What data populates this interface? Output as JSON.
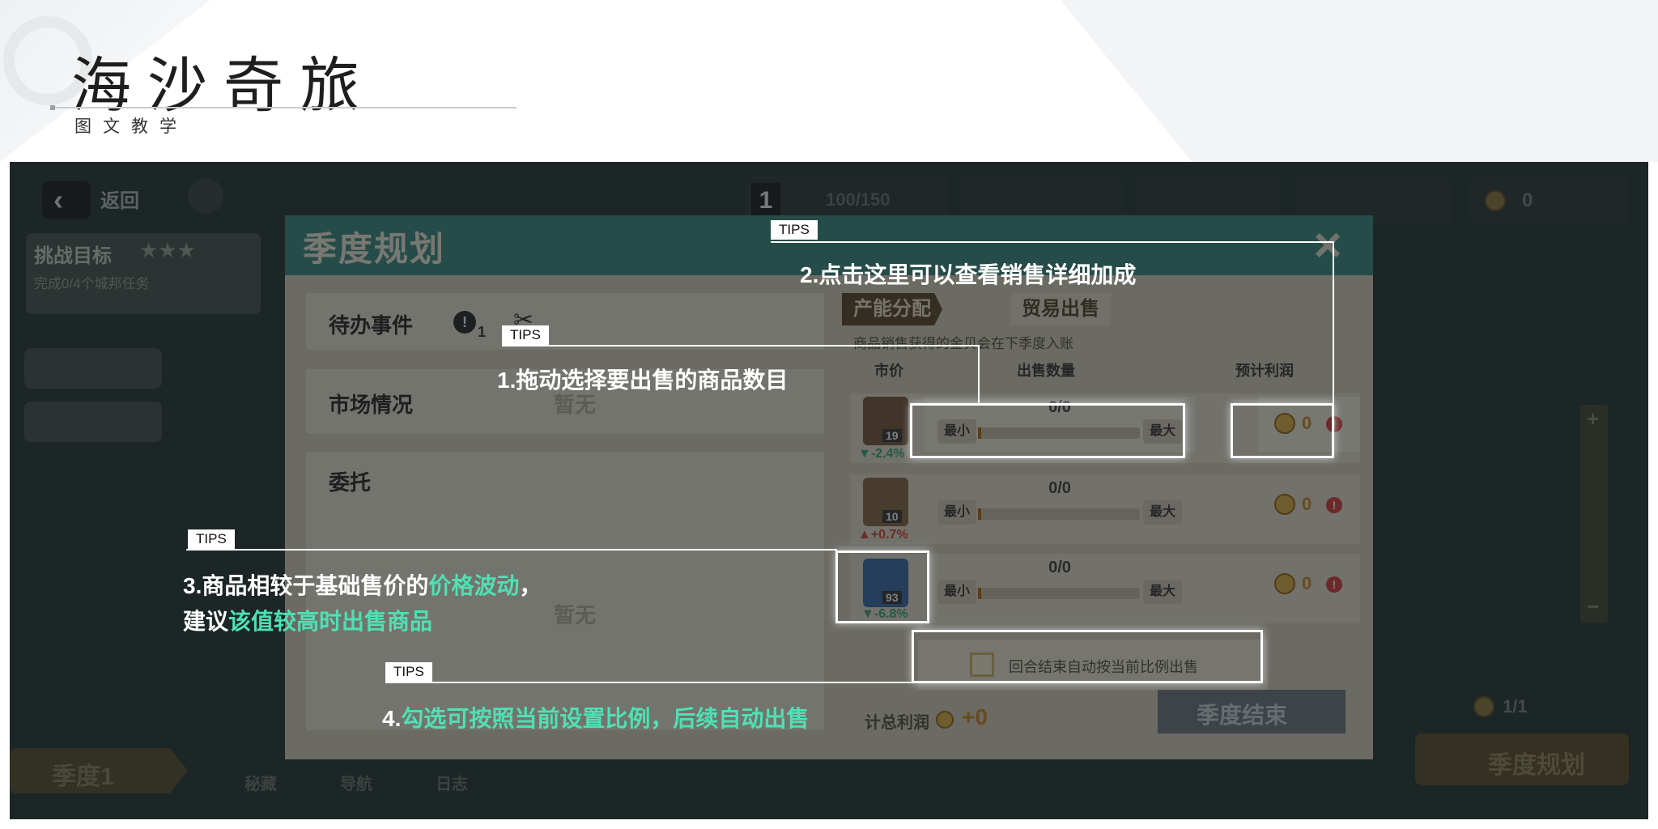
{
  "header": {
    "title": "海沙奇旅",
    "subtitle": "图文教学"
  },
  "game_hud": {
    "back_label": "返回",
    "challenge_label": "挑战目标",
    "challenge_progress": "完成0/4个城邦任务",
    "resource_count": "100/150",
    "coins": "0",
    "season_label": "季度1",
    "bottom_tabs": [
      "秘藏",
      "导航",
      "日志"
    ],
    "season_plan_button": "季度规划",
    "page_counter": "1/1",
    "zoom_plus": "+",
    "zoom_minus": "−",
    "level_badge": "1"
  },
  "dialog": {
    "title": "季度规划",
    "left_panels": [
      {
        "label": "待办事件",
        "badge_count": "1",
        "value": ""
      },
      {
        "label": "市场情况",
        "value": "暂无"
      },
      {
        "label": "委托",
        "value": "暂无"
      }
    ],
    "tabs": [
      "产能分配",
      "贸易出售"
    ],
    "notice": "商品销售获得的金贝会在下季度入账",
    "columns": {
      "price": "市价",
      "qty": "出售数量",
      "profit": "预计利润"
    },
    "rows": [
      {
        "price": "19",
        "change": "▼-2.4%",
        "change_dir": "down",
        "qty": "0/0",
        "profit": "0"
      },
      {
        "price": "10",
        "change": "▲+0.7%",
        "change_dir": "up",
        "qty": "0/0",
        "profit": "0"
      },
      {
        "price": "93",
        "change": "▼-6.8%",
        "change_dir": "down",
        "qty": "0/0",
        "profit": "0"
      }
    ],
    "min_label": "最小",
    "max_label": "最大",
    "auto_sell_label": "回合结束自动按当前比例出售",
    "total_profit_label": "计总利润",
    "total_profit_value": "+0",
    "end_season_button": "季度结束"
  },
  "callouts": {
    "tips_label": "TIPS",
    "tip1": "1.拖动选择要出售的商品数目",
    "tip2": "2.点击这里可以查看销售详细加成",
    "tip3_prefix": "3.商品相较于基础售价的",
    "tip3_green": "价格波动",
    "tip3_suffix": "，",
    "tip3_line2_prefix": "建议",
    "tip3_line2_green": "该值较高时出售商品",
    "tip4_prefix": "4.",
    "tip4_green": "勾选可按照当前设置比例，后续自动出售"
  },
  "colors": {
    "accent_green": "#4fe0b4",
    "dialog_header": "#3e8f86",
    "profit_gold": "#cf8d2a",
    "warn_red": "#d8403f",
    "price_down": "#3aa884",
    "price_up": "#d34b3a"
  }
}
